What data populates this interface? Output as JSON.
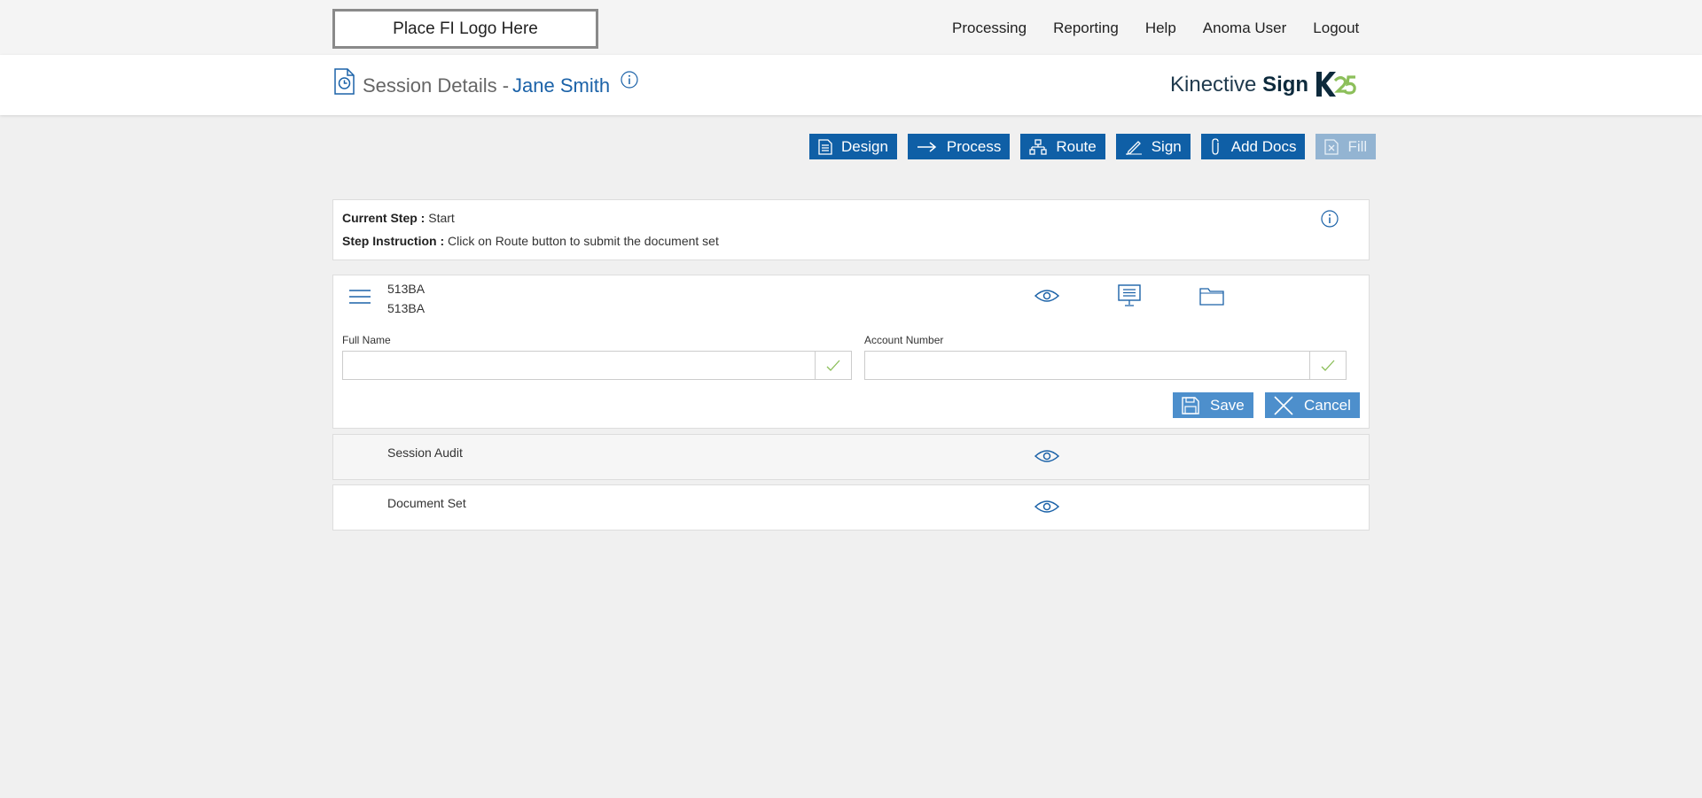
{
  "topbar": {
    "logo_text": "Place FI Logo Here",
    "nav": [
      "Processing",
      "Reporting",
      "Help",
      "Anoma User",
      "Logout"
    ]
  },
  "header": {
    "title": "Session Details -",
    "user_name": "Jane Smith",
    "brand_prefix": "Kinective",
    "brand_strong": "Sign"
  },
  "toolbar": {
    "buttons": [
      {
        "label": "Design",
        "icon": "design-icon",
        "enabled": true
      },
      {
        "label": "Process",
        "icon": "arrow-right-icon",
        "enabled": true
      },
      {
        "label": "Route",
        "icon": "route-icon",
        "enabled": true
      },
      {
        "label": "Sign",
        "icon": "pen-icon",
        "enabled": true
      },
      {
        "label": "Add Docs",
        "icon": "paperclip-icon",
        "enabled": true
      },
      {
        "label": "Fill",
        "icon": "fill-icon",
        "enabled": false
      }
    ]
  },
  "step": {
    "current_label": "Current Step :",
    "current_value": "Start",
    "instruction_label": "Step Instruction :",
    "instruction_value": "Click on Route button to submit the document set"
  },
  "document": {
    "code_line1": "513BA",
    "code_line2": "513BA",
    "fields": [
      {
        "label": "Full Name",
        "value": ""
      },
      {
        "label": "Account Number",
        "value": ""
      }
    ],
    "save_label": "Save",
    "cancel_label": "Cancel"
  },
  "rows": [
    {
      "label": "Session Audit"
    },
    {
      "label": "Document Set"
    }
  ],
  "colors": {
    "primary": "#0f5fa6",
    "primary_disabled": "#93b4d2",
    "secondary_button": "#4d8fcc",
    "link_blue": "#1b62a8",
    "check_green": "#8cbf5a"
  }
}
